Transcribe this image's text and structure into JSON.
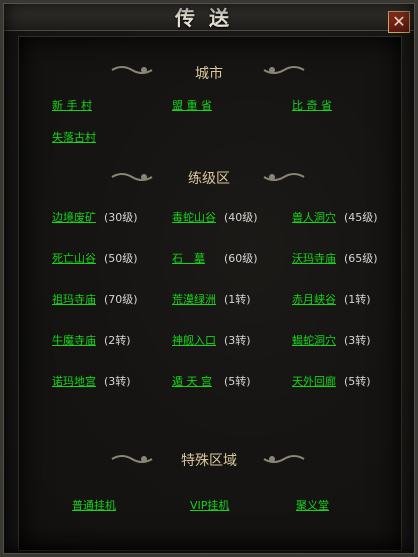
{
  "window": {
    "title": "传送"
  },
  "sections": {
    "city": {
      "title": "城市"
    },
    "training": {
      "title": "练级区"
    },
    "special": {
      "title": "特殊区域"
    }
  },
  "cities": [
    "新 手 村",
    "盟 重 省",
    "比 奇 省",
    "失落古村"
  ],
  "training": [
    {
      "name": "边境废矿",
      "level": "(30级)"
    },
    {
      "name": "毒蛇山谷",
      "level": "(40级)"
    },
    {
      "name": "兽人洞穴",
      "level": "(45级)"
    },
    {
      "name": "死亡山谷",
      "level": "(50级)"
    },
    {
      "name": "石　墓",
      "level": "(60级)"
    },
    {
      "name": "沃玛寺庙",
      "level": "(65级)"
    },
    {
      "name": "祖玛寺庙",
      "level": "(70级)"
    },
    {
      "name": "荒漠绿洲",
      "level": "(1转)"
    },
    {
      "name": "赤月峡谷",
      "level": "(1转)"
    },
    {
      "name": "牛魔寺庙",
      "level": "(2转)"
    },
    {
      "name": "神舰入口",
      "level": "(3转)"
    },
    {
      "name": "蝎蛇洞穴",
      "level": "(3转)"
    },
    {
      "name": "诺玛地宫",
      "level": "(3转)"
    },
    {
      "name": "遁 天 宫",
      "level": "(5转)"
    },
    {
      "name": "天外回廊",
      "level": "(5转)"
    }
  ],
  "special": [
    "普通挂机",
    "VIP挂机",
    "聚义堂"
  ],
  "colors": {
    "link": "#17d41a",
    "title": "#d8c79c",
    "level": "#d6d6d6"
  }
}
